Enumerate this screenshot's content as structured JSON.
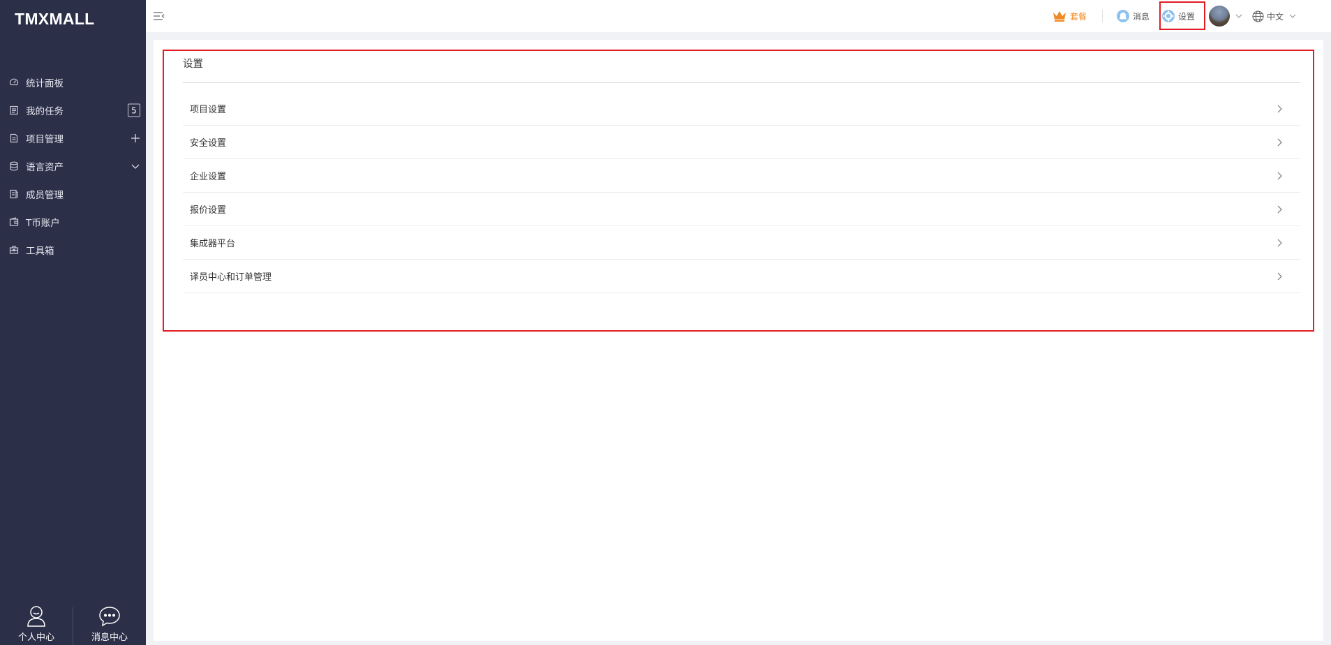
{
  "sidebar": {
    "logo": "TMXMALL",
    "items": [
      {
        "label": "统计面板",
        "icon": "dashboard-icon"
      },
      {
        "label": "我的任务",
        "icon": "task-icon",
        "badge": "5"
      },
      {
        "label": "项目管理",
        "icon": "project-icon",
        "right_icon": "plus-icon"
      },
      {
        "label": "语言资产",
        "icon": "database-icon",
        "right_icon": "chevron-down-icon"
      },
      {
        "label": "成员管理",
        "icon": "members-icon"
      },
      {
        "label": "T币账户",
        "icon": "wallet-icon"
      },
      {
        "label": "工具箱",
        "icon": "toolbox-icon"
      }
    ],
    "bottom": {
      "profile_label": "个人中心",
      "messages_label": "消息中心"
    }
  },
  "header": {
    "package_label": "套餐",
    "messages_label": "消息",
    "settings_label": "设置",
    "language_label": "中文"
  },
  "colors": {
    "sidebar_bg": "#2c2f48",
    "accent_orange": "#f08a24",
    "highlight_red": "#e11c24",
    "message_icon_blue": "#7fb8ea"
  },
  "panel": {
    "title": "设置",
    "rows": [
      {
        "label": "项目设置"
      },
      {
        "label": "安全设置"
      },
      {
        "label": "企业设置"
      },
      {
        "label": "报价设置"
      },
      {
        "label": "集成器平台"
      },
      {
        "label": "译员中心和订单管理"
      }
    ]
  }
}
